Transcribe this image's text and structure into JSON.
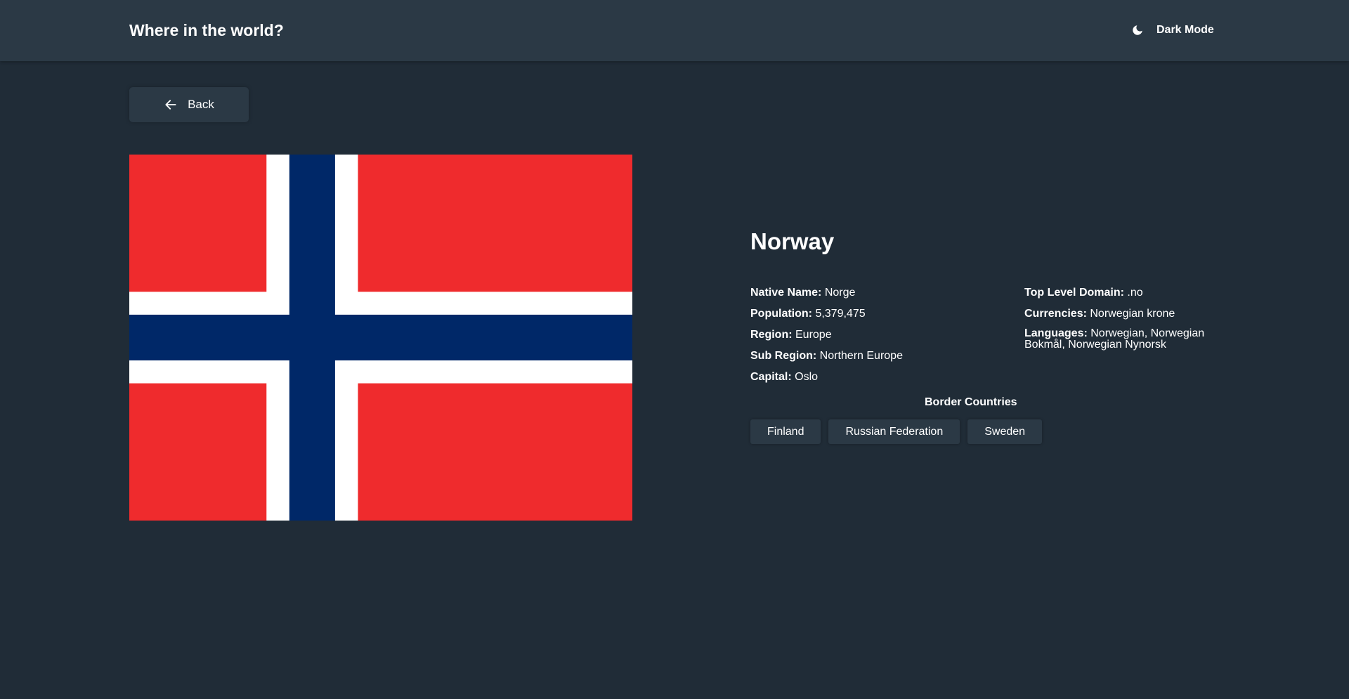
{
  "header": {
    "title": "Where in the world?",
    "theme_toggle_label": "Dark Mode",
    "theme_icon": "moon-icon"
  },
  "navigation": {
    "back_label": "Back",
    "back_icon": "arrow-left-icon"
  },
  "country": {
    "name": "Norway",
    "flag_colors": {
      "red": "#ef2b2d",
      "white": "#ffffff",
      "blue": "#002868"
    },
    "details_left": [
      {
        "label": "Native Name:",
        "value": "Norge"
      },
      {
        "label": "Population:",
        "value": "5,379,475"
      },
      {
        "label": "Region:",
        "value": "Europe"
      },
      {
        "label": "Sub Region:",
        "value": "Northern Europe"
      },
      {
        "label": "Capital:",
        "value": "Oslo"
      }
    ],
    "details_right": [
      {
        "label": "Top Level Domain:",
        "value": ".no"
      },
      {
        "label": "Currencies:",
        "value": "Norwegian krone"
      },
      {
        "label": "Languages:",
        "value": "Norwegian, Norwegian Bokmål, Norwegian Nynorsk"
      }
    ],
    "border_title": "Border Countries",
    "borders": [
      "Finland",
      "Russian Federation",
      "Sweden"
    ]
  },
  "colors": {
    "background": "#202c37",
    "elements": "#2b3945",
    "text": "#ffffff"
  }
}
